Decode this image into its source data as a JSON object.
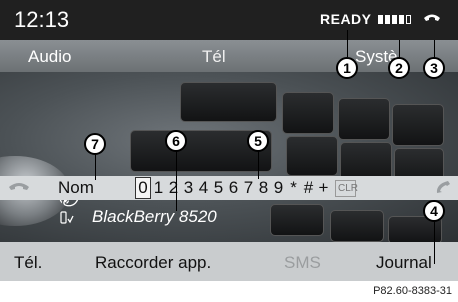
{
  "status": {
    "time": "12:13",
    "ready": "READY"
  },
  "menu": {
    "audio": "Audio",
    "tel": "Tél",
    "sys": "Systè"
  },
  "input": {
    "field_label": "Nom",
    "characters": [
      "0",
      "1",
      "2",
      "3",
      "4",
      "5",
      "6",
      "7",
      "8",
      "9",
      "*",
      "#",
      "+"
    ],
    "selected_character": "0",
    "clear": "CLR"
  },
  "device": {
    "name": "BlackBerry 8520"
  },
  "softkeys": {
    "tel": "Tél.",
    "connect": "Raccorder app.",
    "sms": "SMS",
    "journal": "Journal"
  },
  "callouts": {
    "c1": "1",
    "c2": "2",
    "c3": "3",
    "c4": "4",
    "c5": "5",
    "c6": "6",
    "c7": "7"
  },
  "caption": "P82.60-8383-31",
  "colors": {
    "screen_bg": "#171717",
    "menu_bar": "#7c8184",
    "input_bar": "#d7dadc",
    "softkey_bar": "#c9ccce"
  }
}
